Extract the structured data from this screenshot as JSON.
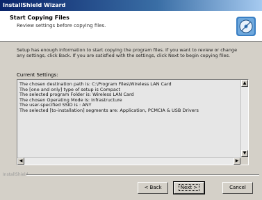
{
  "window": {
    "title": "InstallShield Wizard"
  },
  "header": {
    "title": "Start Copying Files",
    "subtitle": "Review settings before copying files.",
    "icon": "installer-disc-icon"
  },
  "description": "Setup has enough information to start copying the program files. If you want to review or change any settings, click Back. If you are satisfied with the settings, click Next to begin copying files.",
  "settings_label": "Current Settings:",
  "settings_lines": [
    "The chosen destination path is: C:\\Program Files\\Wireless LAN Card",
    "The [one and only] type of setup is Compact",
    "The selected program Folder is: Wireless LAN Card",
    "The chosen Operating Mode is: Infrastructure",
    "The user-specified SSID is : ANY",
    "The selected [to-installation] segments are: Application, PCMCIA & USB Drivers"
  ],
  "brand": "InstallShield",
  "buttons": {
    "back": "< Back",
    "next": "Next >",
    "cancel": "Cancel"
  },
  "colors": {
    "titlebar_start": "#0a246a",
    "titlebar_end": "#a6caf0",
    "face": "#d4d0c8"
  }
}
